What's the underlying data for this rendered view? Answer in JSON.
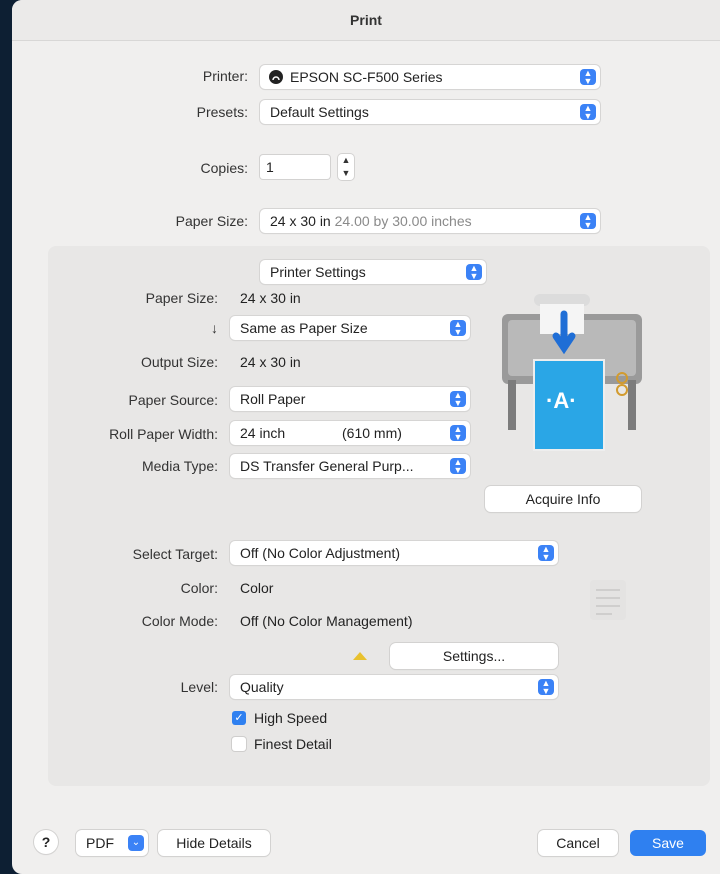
{
  "window": {
    "title": "Print"
  },
  "printer": {
    "label": "Printer:",
    "value": "EPSON SC-F500 Series"
  },
  "presets": {
    "label": "Presets:",
    "value": "Default Settings"
  },
  "copies": {
    "label": "Copies:",
    "value": "1"
  },
  "paper_size": {
    "label": "Paper Size:",
    "value_main": "24 x 30 in",
    "value_detail": "24.00 by 30.00 inches"
  },
  "section": {
    "value": "Printer Settings"
  },
  "printer_settings": {
    "paper_size_label": "Paper Size:",
    "paper_size_value": "24 x 30 in",
    "scale_arrow": "↓",
    "scale_value": "Same as Paper Size",
    "output_size_label": "Output Size:",
    "output_size_value": "24 x 30 in",
    "paper_source_label": "Paper Source:",
    "paper_source_value": "Roll Paper",
    "roll_width_label": "Roll Paper Width:",
    "roll_width_value": "24 inch",
    "roll_width_mm": "(610 mm)",
    "media_type_label": "Media Type:",
    "media_type_value": "DS Transfer General Purp...",
    "acquire_info": "Acquire Info",
    "select_target_label": "Select Target:",
    "select_target_value": "Off (No Color Adjustment)",
    "color_label": "Color:",
    "color_value": "Color",
    "color_mode_label": "Color Mode:",
    "color_mode_value": "Off (No Color Management)",
    "settings_button": "Settings...",
    "level_label": "Level:",
    "level_value": "Quality",
    "high_speed_label": "High Speed",
    "high_speed_checked": true,
    "finest_detail_label": "Finest Detail",
    "finest_detail_checked": false
  },
  "footer": {
    "help": "?",
    "pdf": "PDF",
    "hide_details": "Hide Details",
    "cancel": "Cancel",
    "save": "Save"
  },
  "colors": {
    "accent": "#2f80f0",
    "window_bg": "#f0efee",
    "desktop_bg": "#0d1f33"
  },
  "icons": [
    "printer-status-icon",
    "popup-stepper-icon",
    "printer-illustration",
    "warning-icon",
    "list-icon",
    "help-icon",
    "chevron-down-icon"
  ]
}
